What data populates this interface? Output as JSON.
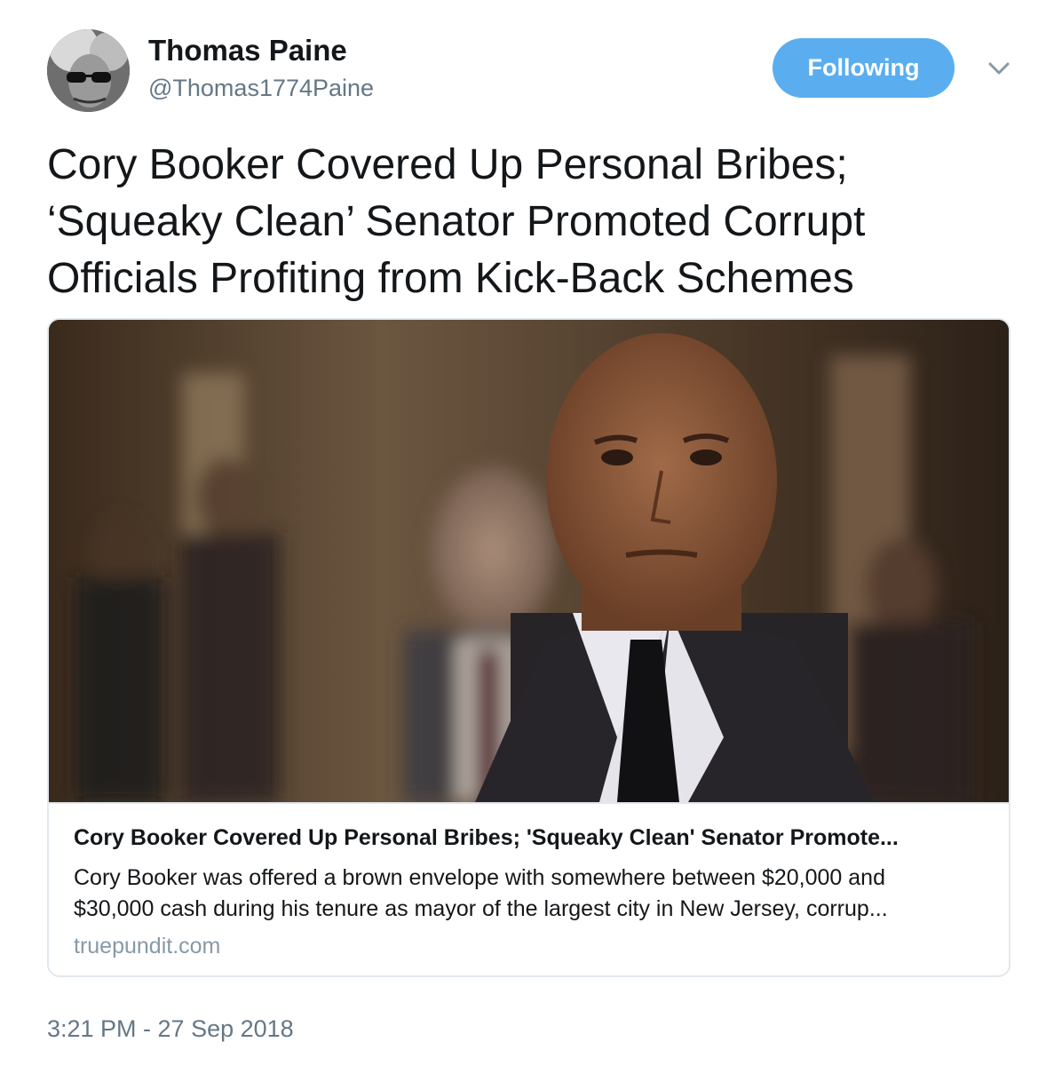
{
  "author": {
    "name": "Thomas Paine",
    "handle": "@Thomas1774Paine"
  },
  "follow_button": {
    "label": "Following",
    "color": "#5aaeef"
  },
  "menu_icon": "chevron-down-icon",
  "tweet": {
    "text_lines": [
      "Cory Booker Covered Up Personal Bribes;",
      "‘Squeaky Clean’ Senator Promoted Corrupt",
      "Officials Profiting from Kick-Back Schemes"
    ]
  },
  "card": {
    "title": "Cory Booker Covered Up Personal Bribes; 'Squeaky Clean' Senator Promote...",
    "description_lines": [
      "Cory Booker was offered a brown envelope with somewhere between $20,000 and",
      "$30,000 cash during his tenure as mayor of the largest city in New Jersey, corrup..."
    ],
    "domain": "truepundit.com"
  },
  "timestamp": "3:21 PM - 27 Sep 2018"
}
